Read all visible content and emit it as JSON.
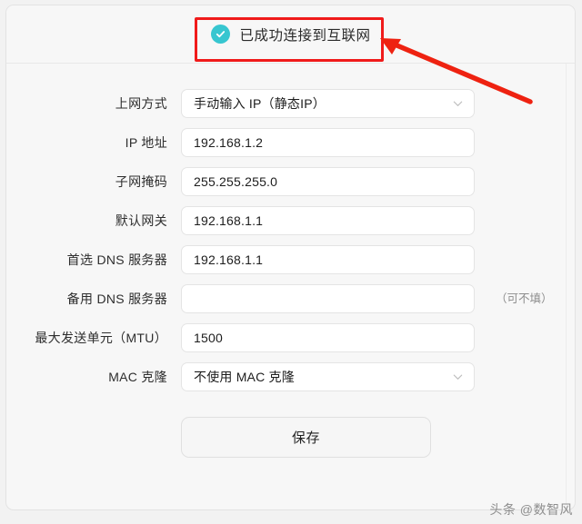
{
  "status_banner": {
    "icon": "check-circle-icon",
    "text": "已成功连接到互联网"
  },
  "annotations": {
    "highlight_box_color": "#f01b1b",
    "arrow_color": "#ee2211"
  },
  "form": {
    "rows": [
      {
        "label": "上网方式",
        "type": "select",
        "value": "手动输入 IP（静态IP）",
        "name": "connection-type",
        "hint": ""
      },
      {
        "label": "IP 地址",
        "type": "text",
        "value": "192.168.1.2",
        "name": "ip-address",
        "hint": ""
      },
      {
        "label": "子网掩码",
        "type": "text",
        "value": "255.255.255.0",
        "name": "subnet-mask",
        "hint": ""
      },
      {
        "label": "默认网关",
        "type": "text",
        "value": "192.168.1.1",
        "name": "default-gateway",
        "hint": ""
      },
      {
        "label": "首选 DNS 服务器",
        "type": "text",
        "value": "192.168.1.1",
        "name": "primary-dns",
        "hint": ""
      },
      {
        "label": "备用 DNS 服务器",
        "type": "text",
        "value": "",
        "placeholder": "",
        "name": "secondary-dns",
        "hint": "（可不填）"
      },
      {
        "label": "最大发送单元（MTU）",
        "type": "text",
        "value": "1500",
        "name": "mtu",
        "hint": ""
      },
      {
        "label": "MAC 克隆",
        "type": "select",
        "value": "不使用 MAC 克隆",
        "name": "mac-clone",
        "hint": ""
      }
    ],
    "save_label": "保存"
  },
  "watermark": {
    "text": "头条 @数智风"
  }
}
